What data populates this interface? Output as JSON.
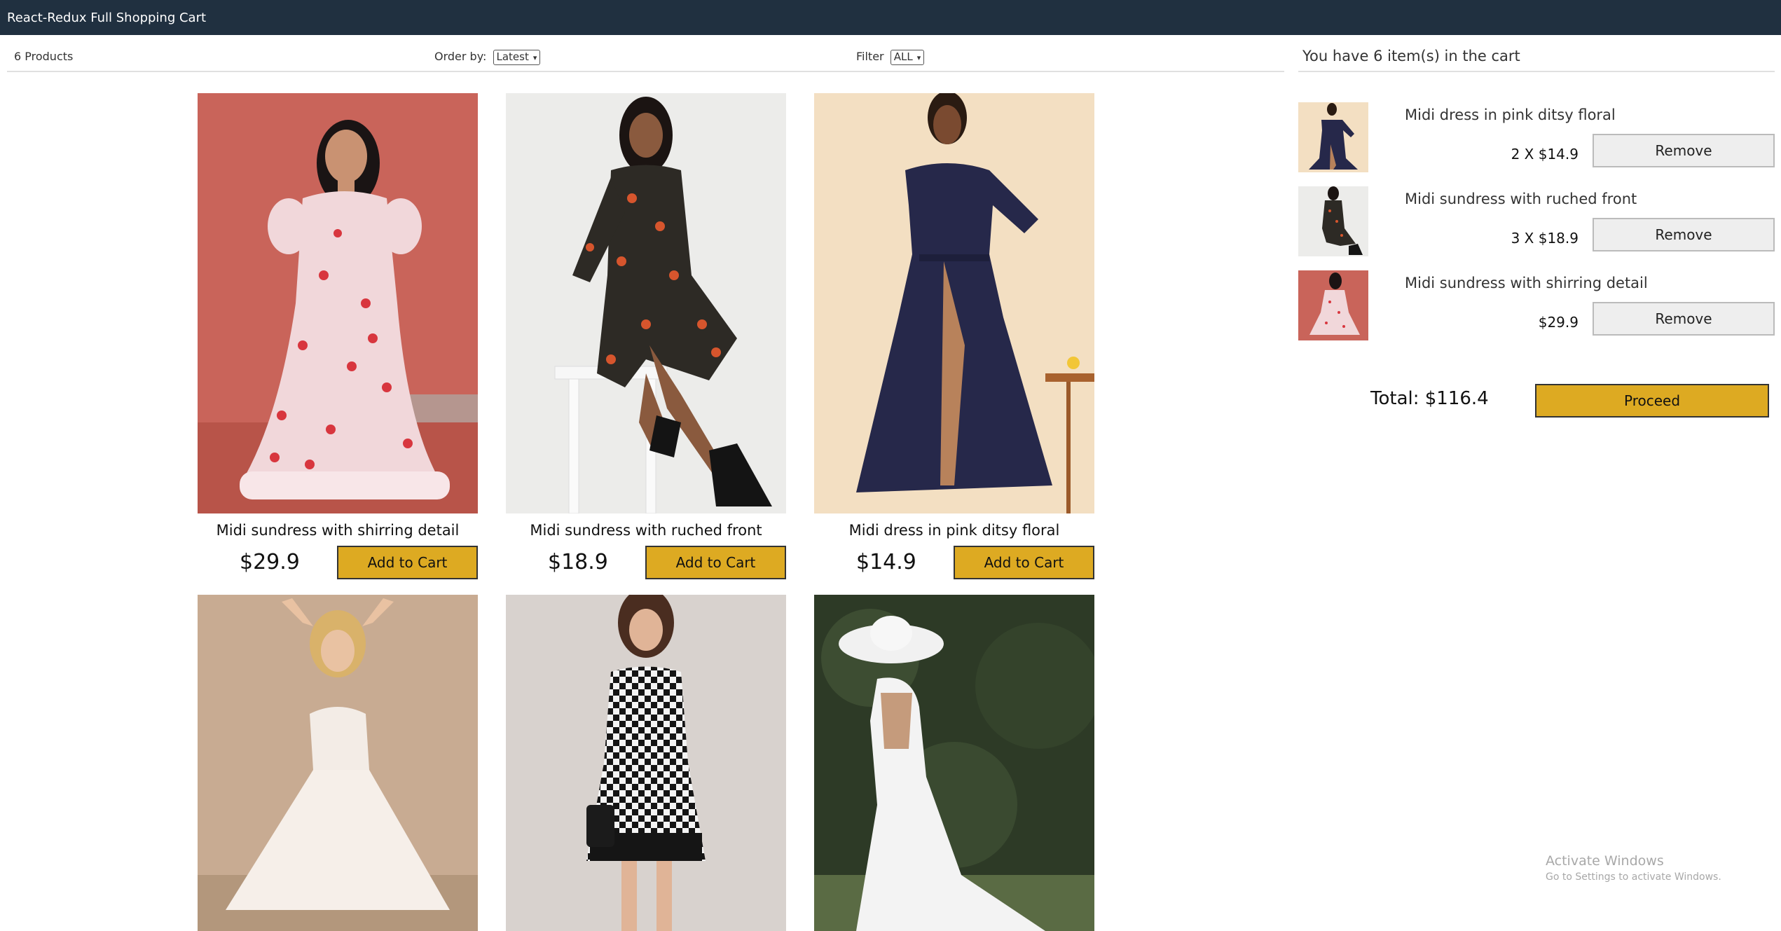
{
  "app": {
    "title": "React-Redux Full Shopping Cart"
  },
  "filter_bar": {
    "count_text": "6 Products",
    "order_label": "Order by:",
    "order_value": "Latest",
    "filter_label": "Filter",
    "filter_value": "ALL"
  },
  "products": [
    {
      "name": "Midi sundress with shirring detail",
      "price": "$29.9",
      "button": "Add to Cart"
    },
    {
      "name": "Midi sundress with ruched front",
      "price": "$18.9",
      "button": "Add to Cart"
    },
    {
      "name": "Midi dress in pink ditsy floral",
      "price": "$14.9",
      "button": "Add to Cart"
    },
    {
      "name": "",
      "price": "",
      "button": ""
    },
    {
      "name": "",
      "price": "",
      "button": ""
    },
    {
      "name": "",
      "price": "",
      "button": ""
    }
  ],
  "cart": {
    "header": "You have 6 item(s) in the cart",
    "items": [
      {
        "title": "Midi dress in pink ditsy floral",
        "qty_price": "2 X $14.9",
        "button": "Remove"
      },
      {
        "title": "Midi sundress with ruched front",
        "qty_price": "3 X $18.9",
        "button": "Remove"
      },
      {
        "title": "Midi sundress with shirring detail",
        "qty_price": "$29.9",
        "button": "Remove"
      }
    ],
    "total": "Total: $116.4",
    "proceed": "Proceed"
  },
  "os_watermark": {
    "line1": "Activate Windows",
    "line2": "Go to Settings to activate Windows."
  },
  "colors": {
    "topbar": "#203040",
    "accent_button": "#ddaa22",
    "remove_button": "#eeeeee"
  }
}
